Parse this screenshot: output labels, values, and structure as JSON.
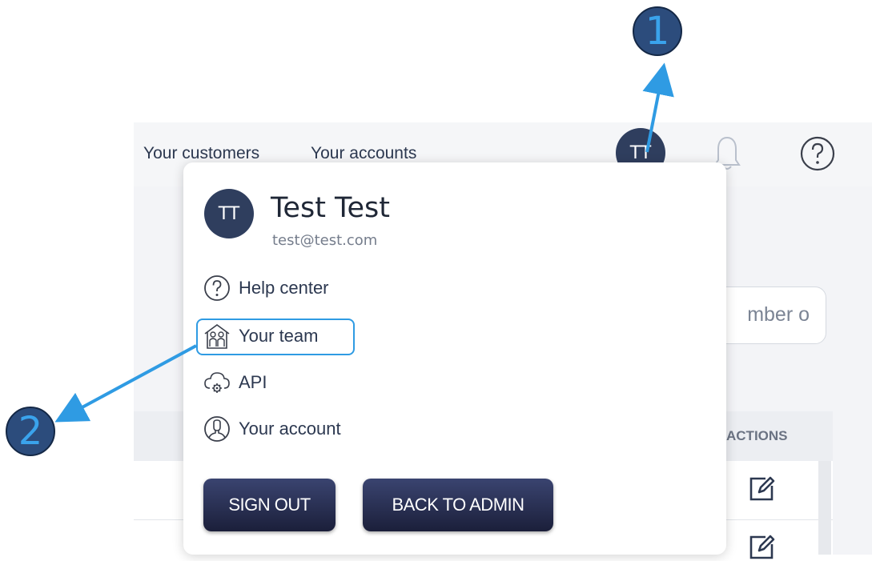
{
  "header": {
    "nav_links": [
      "Your customers",
      "Your accounts"
    ],
    "avatar_initials": "TT"
  },
  "search": {
    "value": "mber o"
  },
  "table": {
    "actions_header": "ACTIONS"
  },
  "dropdown": {
    "avatar_initials": "TT",
    "user_name": "Test Test",
    "user_email": "test@test.com",
    "items": [
      {
        "label": "Help center",
        "icon": "help-circle-icon"
      },
      {
        "label": "Your team",
        "icon": "team-house-icon"
      },
      {
        "label": "API",
        "icon": "cloud-gear-icon"
      },
      {
        "label": "Your account",
        "icon": "user-circle-icon"
      }
    ],
    "buttons": {
      "sign_out": "SIGN OUT",
      "back_to_admin": "BACK TO ADMIN"
    }
  },
  "annotations": {
    "badge_1": "1",
    "badge_2": "2"
  },
  "colors": {
    "accent_blue": "#2f9be3",
    "avatar_navy": "#2f3e5e",
    "button_dark": "#1b1f3a",
    "badge_fill": "#2c4c7c"
  }
}
